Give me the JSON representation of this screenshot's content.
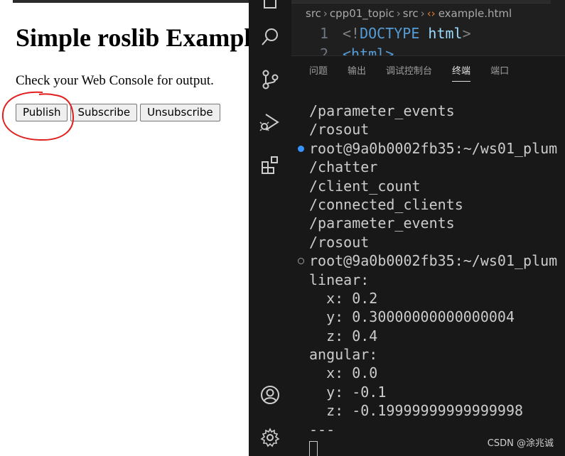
{
  "browser": {
    "title": "Simple roslib Example",
    "instruction": "Check your Web Console for output.",
    "buttons": {
      "publish": "Publish",
      "subscribe": "Subscribe",
      "unsubscribe": "Unsubscribe"
    },
    "annotation_color": "#e0201e"
  },
  "editor": {
    "breadcrumb": [
      "src",
      "cpp01_topic",
      "src",
      "example.html"
    ],
    "line1_number": "1",
    "line1_open": "<!",
    "line1_keyword": "DOCTYPE",
    "line1_tag": " html",
    "line1_close": ">",
    "line2_number": "2",
    "line2_text": "<html>"
  },
  "panel": {
    "tabs": [
      "问题",
      "输出",
      "调试控制台",
      "终端",
      "端口"
    ],
    "active_tab": "终端"
  },
  "terminal": {
    "lines": [
      {
        "text": "/parameter_events",
        "marker": ""
      },
      {
        "text": "/rosout",
        "marker": ""
      },
      {
        "text": "root@9a0b0002fb35:~/ws01_plum",
        "marker": "blue"
      },
      {
        "text": "/chatter",
        "marker": ""
      },
      {
        "text": "/client_count",
        "marker": ""
      },
      {
        "text": "/connected_clients",
        "marker": ""
      },
      {
        "text": "/parameter_events",
        "marker": ""
      },
      {
        "text": "/rosout",
        "marker": ""
      },
      {
        "text": "root@9a0b0002fb35:~/ws01_plum",
        "marker": "hollow"
      },
      {
        "text": "linear:",
        "marker": ""
      },
      {
        "text": "  x: 0.2",
        "marker": ""
      },
      {
        "text": "  y: 0.30000000000000004",
        "marker": ""
      },
      {
        "text": "  z: 0.4",
        "marker": ""
      },
      {
        "text": "angular:",
        "marker": ""
      },
      {
        "text": "  x: 0.0",
        "marker": ""
      },
      {
        "text": "  y: -0.1",
        "marker": ""
      },
      {
        "text": "  z: -0.19999999999999998",
        "marker": ""
      },
      {
        "text": "---",
        "marker": ""
      }
    ]
  },
  "activity_icons": [
    "explorer-icon",
    "search-icon",
    "source-control-icon",
    "run-debug-icon",
    "extensions-icon",
    "account-icon",
    "settings-icon"
  ],
  "watermark": "CSDN @涂兆诚"
}
